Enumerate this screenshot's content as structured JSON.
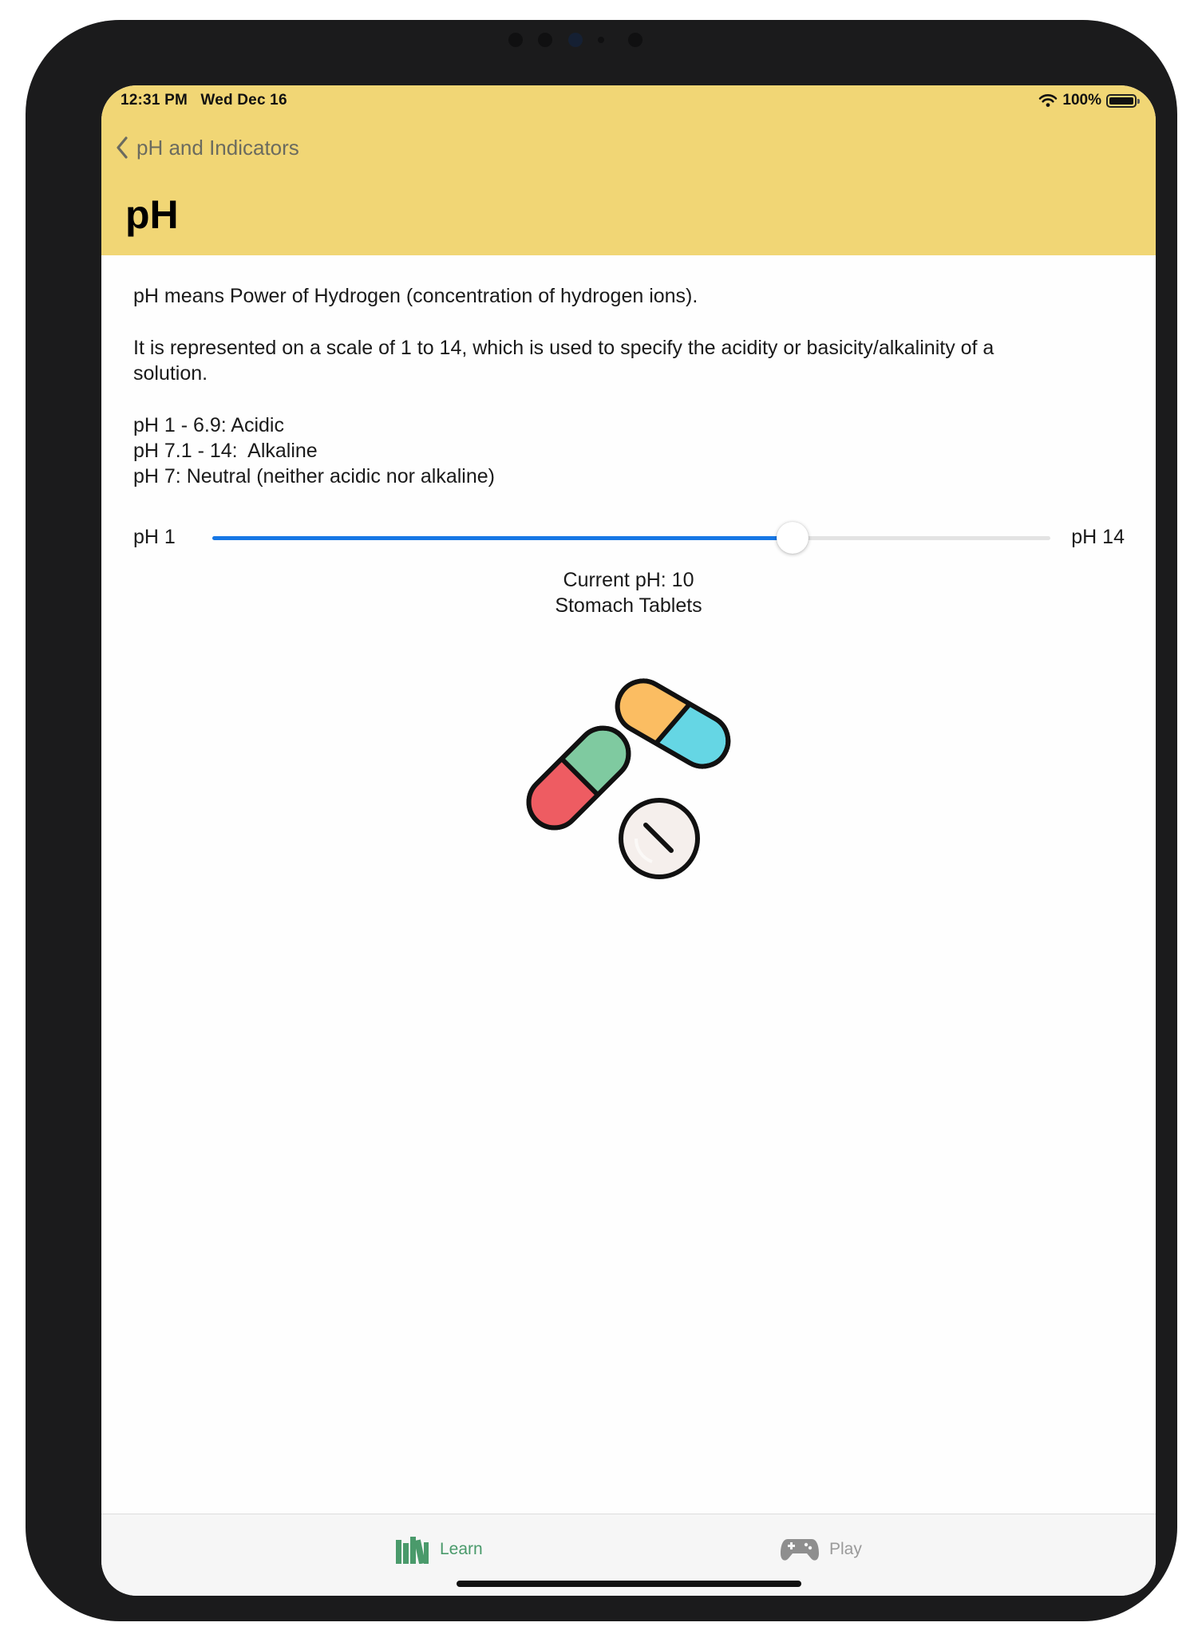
{
  "status_bar": {
    "time_date": "12:31 PM   Wed Dec 16",
    "battery": "100%",
    "battery_level": 1.0,
    "wifi_icon": "wifi-icon",
    "battery_icon": "battery-icon"
  },
  "nav": {
    "back_label": "pH and Indicators",
    "back_icon": "chevron-left-icon",
    "title": "pH"
  },
  "content": {
    "intro": "pH means Power of Hydrogen (concentration of hydrogen ions).",
    "scale_description": "It is represented on a scale of 1 to 14, which is used to specify the acidity or basicity/alkalinity of a solution.",
    "ranges": [
      "pH 1 - 6.9: Acidic",
      "pH 7.1 - 14:  Alkaline",
      "pH 7: Neutral (neither acidic nor alkaline)"
    ]
  },
  "slider": {
    "min_label": "pH 1",
    "max_label": "pH 14",
    "min": 1,
    "max": 14,
    "value": 10,
    "track_color": "#1677e5"
  },
  "reading": {
    "current": "Current pH: 10",
    "sample": "Stomach Tablets",
    "illustration_icon": "pills-icon"
  },
  "tabbar": {
    "tabs": [
      {
        "label": "Learn",
        "icon": "books-icon",
        "selected": true,
        "color": "#4a9a6b"
      },
      {
        "label": "Play",
        "icon": "gamepad-icon",
        "selected": false,
        "color": "#9a9a9a"
      }
    ]
  },
  "colors": {
    "header_bg": "#f1d675",
    "accent": "#1677e5"
  }
}
